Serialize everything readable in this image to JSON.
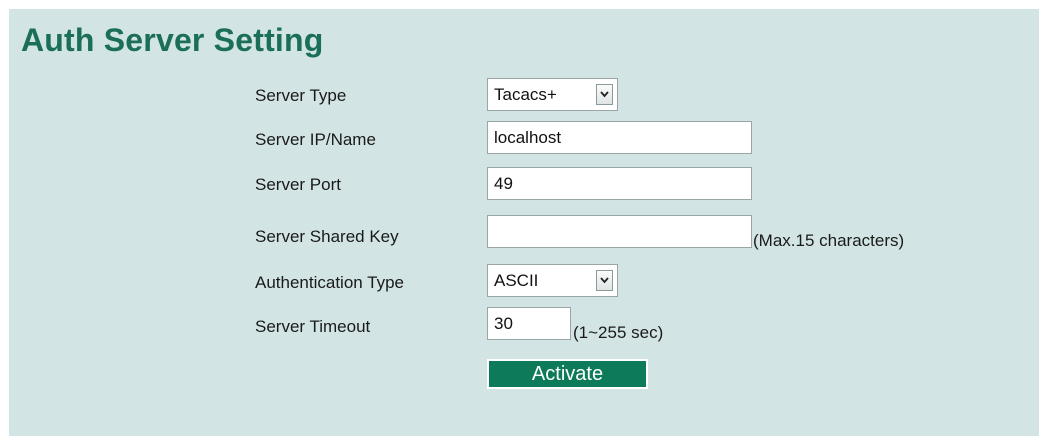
{
  "page": {
    "title": "Auth Server Setting"
  },
  "form": {
    "server_type": {
      "label": "Server Type",
      "value": "Tacacs+"
    },
    "server_ip": {
      "label": "Server IP/Name",
      "value": "localhost"
    },
    "server_port": {
      "label": "Server Port",
      "value": "49"
    },
    "shared_key": {
      "label": "Server Shared Key",
      "value": "",
      "hint": "(Max.15 characters)"
    },
    "auth_type": {
      "label": "Authentication Type",
      "value": "ASCII"
    },
    "timeout": {
      "label": "Server Timeout",
      "value": "30",
      "hint": "(1~255 sec)"
    }
  },
  "actions": {
    "activate_label": "Activate"
  },
  "colors": {
    "panel_background": "#d3e4e4",
    "title": "#1a6e5a",
    "button": "#0d7a5a"
  },
  "icons": {
    "dropdown": "chevron-down-icon"
  }
}
